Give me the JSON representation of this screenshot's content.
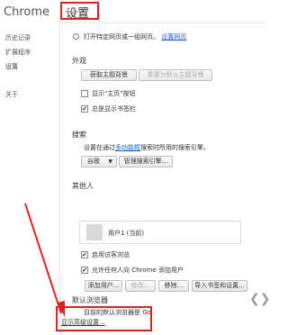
{
  "sidebar": {
    "title": "Chrome",
    "items": [
      {
        "label": "历史记录"
      },
      {
        "label": "扩展程序"
      },
      {
        "label": "设置"
      },
      {
        "label": "关于"
      }
    ]
  },
  "page": {
    "title": "设置"
  },
  "startup": {
    "option_label": "打开特定网页或一组网页。",
    "option_link": "设置网页"
  },
  "appearance": {
    "heading": "外观",
    "get_themes": "获取主题背景",
    "reset_theme": "重置为默认主题背景",
    "show_home": "显示\"主页\"按钮",
    "show_bookmarks": "总是显示书签栏"
  },
  "search": {
    "heading": "搜索",
    "desc_prefix": "设置在通过",
    "desc_link": "多功能框",
    "desc_suffix": "搜索时所用的搜索引擎。",
    "engine": "谷歌",
    "manage": "管理搜索引擎..."
  },
  "people": {
    "heading": "其他人",
    "user": "用户1 (当前)",
    "guest": "启用访客浏览",
    "allow_add": "允许任何人向 Chrome 添加用户",
    "add_user": "添加用户...",
    "edit": "修改...",
    "remove": "移除...",
    "import": "导入书签和设置..."
  },
  "default_browser": {
    "heading": "默认浏览器",
    "desc": "目前的默认浏览器是 Go"
  },
  "advanced": {
    "link": "显示高级设置..."
  },
  "colors": {
    "highlight": "#e02020",
    "link": "#1a5fcc"
  }
}
